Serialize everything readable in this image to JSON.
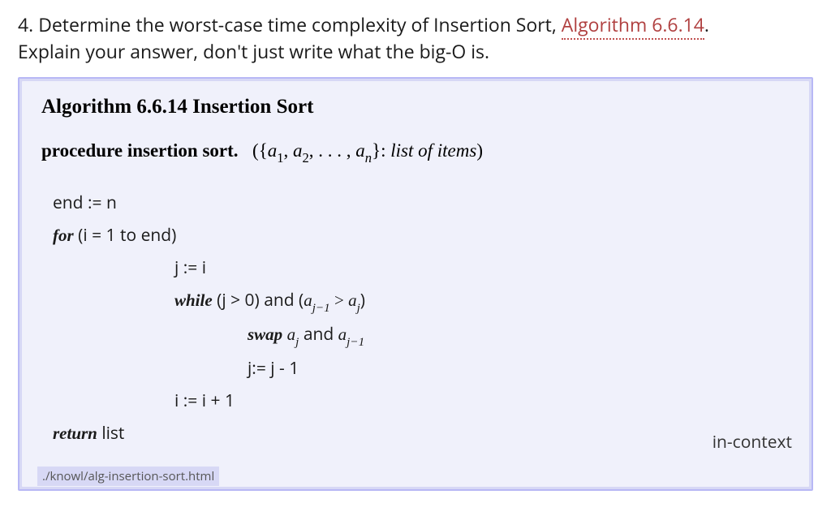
{
  "question": {
    "number": "4.",
    "prefix": "Determine the worst-case time complexity of Insertion Sort, ",
    "link": "Algorithm 6.6.14",
    "suffix": ".",
    "explain": "Explain your answer, don't just write what the big-O is."
  },
  "algorithm": {
    "title": "Algorithm 6.6.14  Insertion Sort",
    "procedure_kw": "procedure insertion sort.",
    "params_open": "({",
    "params_close": "}: ",
    "list_label": "list of items",
    "close_paren": ")",
    "a_items": {
      "a1": "a",
      "sub1": "1",
      "a2": "a",
      "sub2": "2",
      "dots": ", . . . , ",
      "an": "a",
      "subn": "n"
    },
    "lines": {
      "l1": "end := n",
      "for_kw": "for",
      "for_rest": " (i = 1 to end)",
      "l3": "j := i",
      "while_kw": "while",
      "while_rest1": " (j > 0) and (",
      "while_rest2": ")",
      "gt": " > ",
      "swap_kw": "swap",
      "and_text": " and ",
      "l6": "j:= j - 1",
      "l7": "i := i + 1",
      "return_kw": "return",
      "return_rest": " list",
      "aj": "a",
      "subj": "j",
      "ajm1": "a",
      "subjm1": "j−1"
    },
    "in_context": "in-context",
    "path": "./knowl/alg-insertion-sort.html"
  }
}
